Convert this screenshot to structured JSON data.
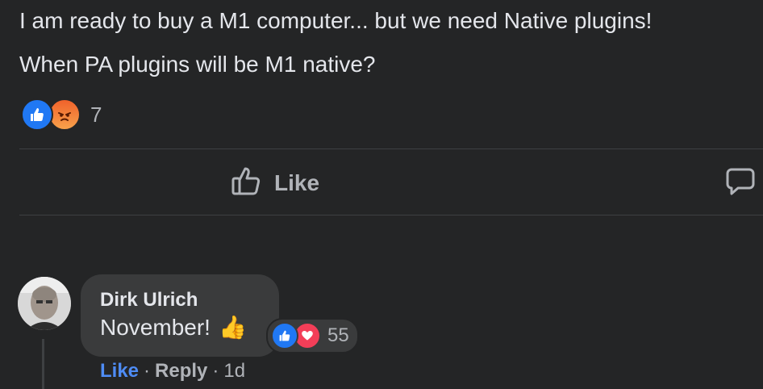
{
  "post": {
    "line1": "I am ready to buy a M1 computer... but we need Native plugins!",
    "line2": "When PA plugins will be M1 native?"
  },
  "reactions": {
    "count": "7",
    "icons": [
      "like-icon",
      "angry-icon"
    ]
  },
  "actions": {
    "like_label": "Like",
    "comment_icon": "comment-icon"
  },
  "comment": {
    "author": "Dirk Ulrich",
    "text": "November!",
    "emoji": "👍",
    "reaction_count": "55",
    "reaction_icons": [
      "like-icon",
      "love-icon"
    ],
    "like_label": "Like",
    "separator": "·",
    "reply_label": "Reply",
    "time": "1d"
  },
  "colors": {
    "background": "#242526",
    "bubble": "#3a3b3c",
    "like_blue": "#2078f4",
    "link_blue": "#4e8cf5",
    "love_red": "#f33e58",
    "text_secondary": "#b0b3b8"
  }
}
